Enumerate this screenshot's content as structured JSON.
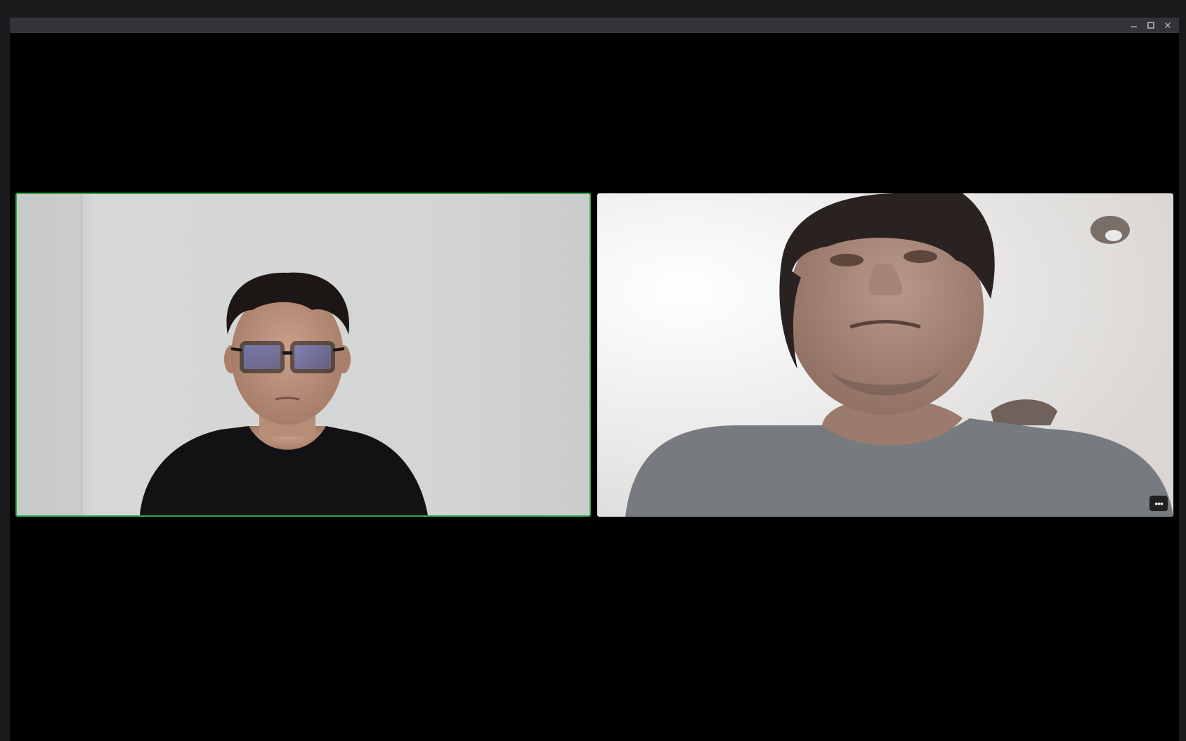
{
  "window": {
    "controls": {
      "minimize_icon": "minimize-icon",
      "maximize_icon": "maximize-icon",
      "close_icon": "close-icon"
    }
  },
  "gallery": {
    "active_speaker_color": "#33a852",
    "participants": [
      {
        "tile": "left",
        "active_speaker": true,
        "video": "person-with-glasses-black-tshirt-white-wall"
      },
      {
        "tile": "right",
        "active_speaker": false,
        "video": "person-closeup-low-angle-bright-room",
        "more_options_icon": "more-options-icon",
        "more_options_glyph": "•••"
      }
    ]
  }
}
